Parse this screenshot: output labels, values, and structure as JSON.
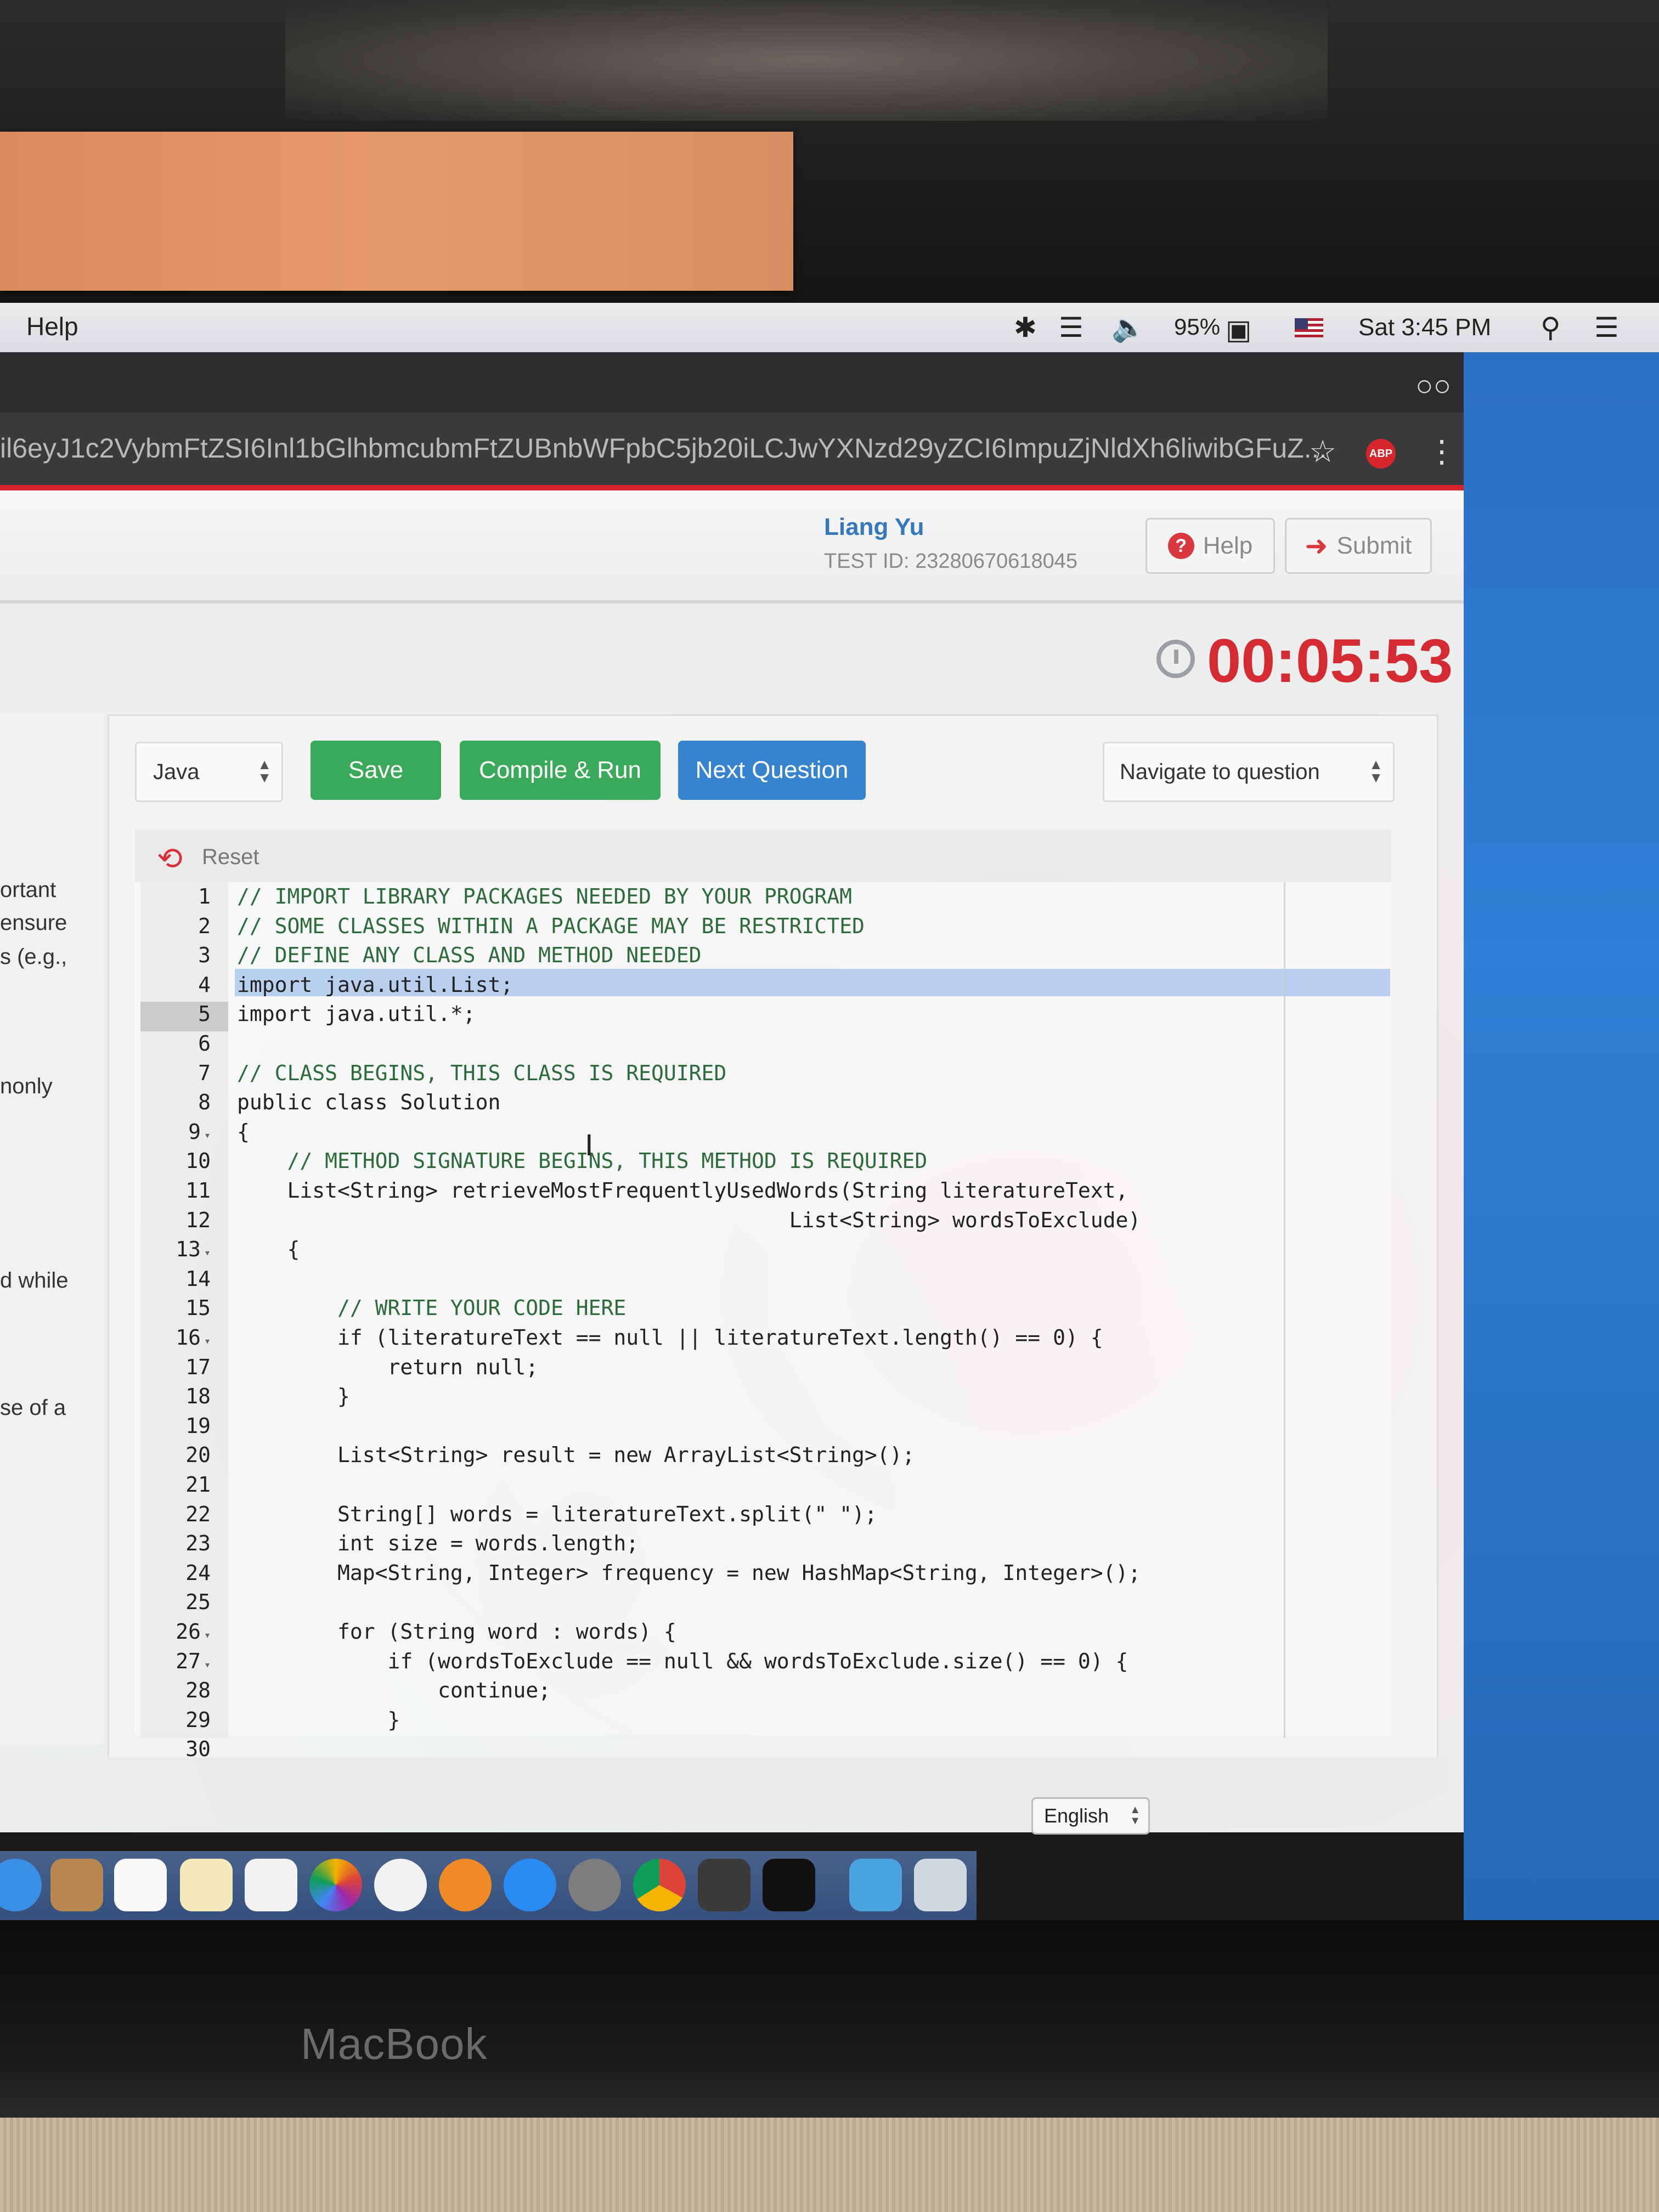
{
  "menubar": {
    "menu_help": "Help",
    "battery_pct": "95%",
    "clock": "Sat 3:45 PM",
    "icons": [
      "bluetooth-icon",
      "wifi-icon",
      "volume-icon",
      "battery-icon",
      "flag-icon",
      "spotlight-icon",
      "notification-center-icon"
    ]
  },
  "browser": {
    "url": "il6eyJ1c2VybmFtZSI6Inl1bGlhbmcubmFtZUBnbWFpbC5jb20iLCJwYXNzd29yZCI6ImpuZjNldXh6liwibGFuZ...",
    "abp_label": "ABP"
  },
  "header": {
    "user_name": "Liang Yu",
    "test_id": "TEST ID: 23280670618045",
    "help_label": "Help",
    "submit_label": "Submit"
  },
  "timer": "00:05:53",
  "left_panel_fragments": [
    "ortant",
    "ensure",
    "s (e.g.,",
    "nonly",
    "d while",
    "se of a"
  ],
  "toolbar": {
    "language": "Java",
    "save_label": "Save",
    "compile_label": "Compile & Run",
    "next_label": "Next Question",
    "navigate_label": "Navigate to question"
  },
  "editor": {
    "reset_label": "Reset",
    "line_numbers": [
      "1",
      "2",
      "3",
      "4",
      "5",
      "6",
      "7",
      "8",
      "9",
      "10",
      "11",
      "12",
      "13",
      "14",
      "15",
      "16",
      "17",
      "18",
      "19",
      "20",
      "21",
      "22",
      "23",
      "24",
      "25",
      "26",
      "27",
      "28",
      "29",
      "30"
    ],
    "lines": [
      "// IMPORT LIBRARY PACKAGES NEEDED BY YOUR PROGRAM",
      "// SOME CLASSES WITHIN A PACKAGE MAY BE RESTRICTED",
      "// DEFINE ANY CLASS AND METHOD NEEDED",
      "import java.util.List;",
      "import java.util.*;",
      "",
      "// CLASS BEGINS, THIS CLASS IS REQUIRED",
      "public class Solution",
      "{",
      "    // METHOD SIGNATURE BEGINS, THIS METHOD IS REQUIRED",
      "    List<String> retrieveMostFrequentlyUsedWords(String literatureText,",
      "                                            List<String> wordsToExclude)",
      "    {",
      "",
      "        // WRITE YOUR CODE HERE",
      "        if (literatureText == null || literatureText.length() == 0) {",
      "            return null;",
      "        }",
      "",
      "        List<String> result = new ArrayList<String>();",
      "",
      "        String[] words = literatureText.split(\" \");",
      "        int size = words.length;",
      "        Map<String, Integer> frequency = new HashMap<String, Integer>();",
      "",
      "        for (String word : words) {",
      "            if (wordsToExclude == null && wordsToExclude.size() == 0) {",
      "                continue;",
      "            }",
      ""
    ]
  },
  "footer": {
    "language": "English"
  },
  "device": {
    "label": "MacBook"
  }
}
